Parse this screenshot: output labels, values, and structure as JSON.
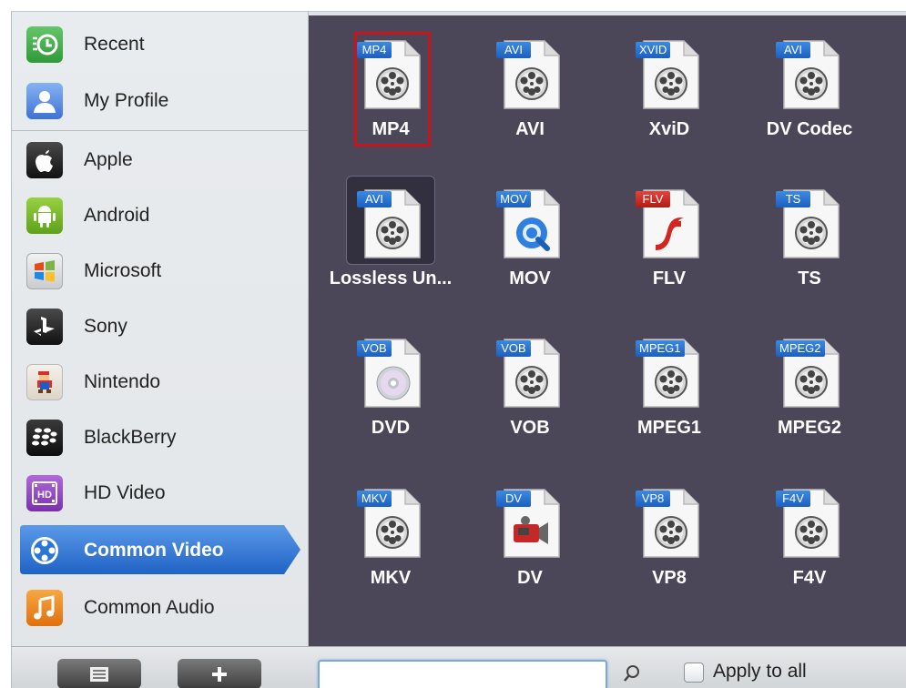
{
  "sidebar": {
    "items": [
      {
        "label": "Recent",
        "icon": "clock-icon",
        "color": "#4caf50"
      },
      {
        "label": "My Profile",
        "icon": "user-icon",
        "color": "#5b8ee0"
      },
      {
        "label": "Apple",
        "icon": "apple-icon",
        "color": "#1e1e1e"
      },
      {
        "label": "Android",
        "icon": "android-icon",
        "color": "#7cbf2b"
      },
      {
        "label": "Microsoft",
        "icon": "windows-icon",
        "color": "#d8dadc"
      },
      {
        "label": "Sony",
        "icon": "playstation-icon",
        "color": "#1e1e1e"
      },
      {
        "label": "Nintendo",
        "icon": "mario-icon",
        "color": "#e9e4dc"
      },
      {
        "label": "BlackBerry",
        "icon": "blackberry-icon",
        "color": "#1e1e1e"
      },
      {
        "label": "HD Video",
        "icon": "hd-film-icon",
        "color": "#9c4fc9"
      },
      {
        "label": "Common Video",
        "icon": "film-reel-icon",
        "color": "#2b75d3",
        "selected": true
      },
      {
        "label": "Common Audio",
        "icon": "music-note-icon",
        "color": "#f08a1f"
      }
    ]
  },
  "grid": {
    "tiles": [
      {
        "tag": "MP4",
        "caption": "MP4",
        "icon": "film-reel-icon",
        "highlighted": true
      },
      {
        "tag": "AVI",
        "caption": "AVI",
        "icon": "film-reel-icon"
      },
      {
        "tag": "XVID",
        "caption": "XviD",
        "icon": "film-reel-icon"
      },
      {
        "tag": "AVI",
        "caption": "DV Codec",
        "icon": "film-reel-icon"
      },
      {
        "tag": "AVI",
        "caption": "Lossless Un...",
        "icon": "film-reel-icon",
        "selected": true
      },
      {
        "tag": "MOV",
        "caption": "MOV",
        "icon": "quicktime-icon"
      },
      {
        "tag": "FLV",
        "caption": "FLV",
        "icon": "flash-icon",
        "red": true
      },
      {
        "tag": "TS",
        "caption": "TS",
        "icon": "film-reel-icon"
      },
      {
        "tag": "VOB",
        "caption": "DVD",
        "icon": "disc-icon"
      },
      {
        "tag": "VOB",
        "caption": "VOB",
        "icon": "film-reel-icon"
      },
      {
        "tag": "MPEG1",
        "caption": "MPEG1",
        "icon": "film-reel-icon"
      },
      {
        "tag": "MPEG2",
        "caption": "MPEG2",
        "icon": "film-reel-icon"
      },
      {
        "tag": "MKV",
        "caption": "MKV",
        "icon": "film-reel-icon"
      },
      {
        "tag": "DV",
        "caption": "DV",
        "icon": "camcorder-icon"
      },
      {
        "tag": "VP8",
        "caption": "VP8",
        "icon": "film-reel-icon"
      },
      {
        "tag": "F4V",
        "caption": "F4V",
        "icon": "film-reel-icon"
      }
    ]
  },
  "bottombar": {
    "search_value": "",
    "apply_label": "Apply to all",
    "apply_checked": false
  },
  "colors": {
    "grid_bg": "#4b4758",
    "selection_blue": "#2b75d3",
    "highlight_red": "#c8141b"
  }
}
